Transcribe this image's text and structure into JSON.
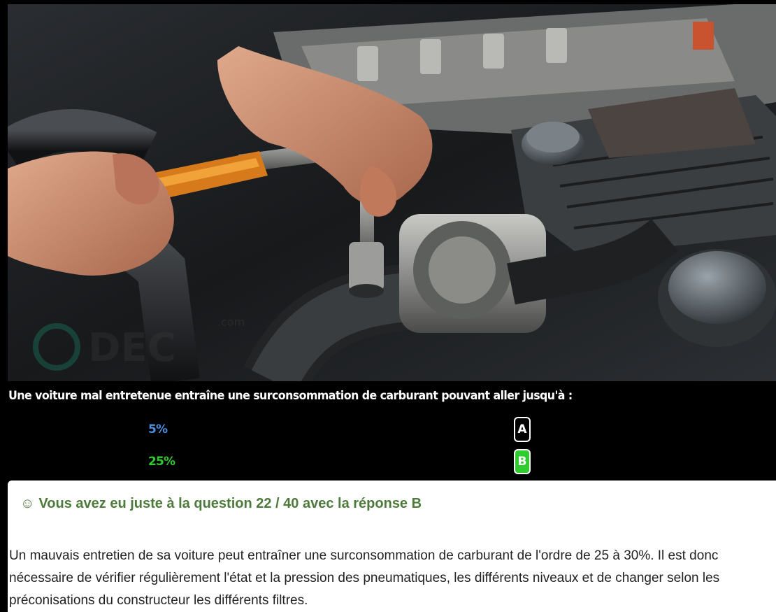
{
  "question": {
    "text": "Une voiture mal entretenue entraîne une surconsommation de carburant pouvant aller jusqu'à :"
  },
  "answers": [
    {
      "text": "5%",
      "letter": "A",
      "state": "neutral",
      "color": "#4a8fe0"
    },
    {
      "text": "25%",
      "letter": "B",
      "state": "correct",
      "color": "#2fcc2f"
    }
  ],
  "result": {
    "icon": "smiley-icon",
    "smiley": "☺",
    "title": "Vous avez eu juste à la question 22 / 40 avec la réponse B",
    "title_color": "#4c7a3a",
    "explanation": "Un mauvais entretien de sa voiture peut entraîner une surconsommation de carburant de l'ordre de 25 à 30%. Il est donc nécessaire de vérifier régulièrement l'état et la pression des pneumatiques, les différents niveaux et de changer selon les préconisations du constructeur les différents filtres."
  },
  "hero_image": {
    "description_icon": "engine-photo",
    "watermark_text": "DEC",
    "watermark_sub": ".com"
  }
}
